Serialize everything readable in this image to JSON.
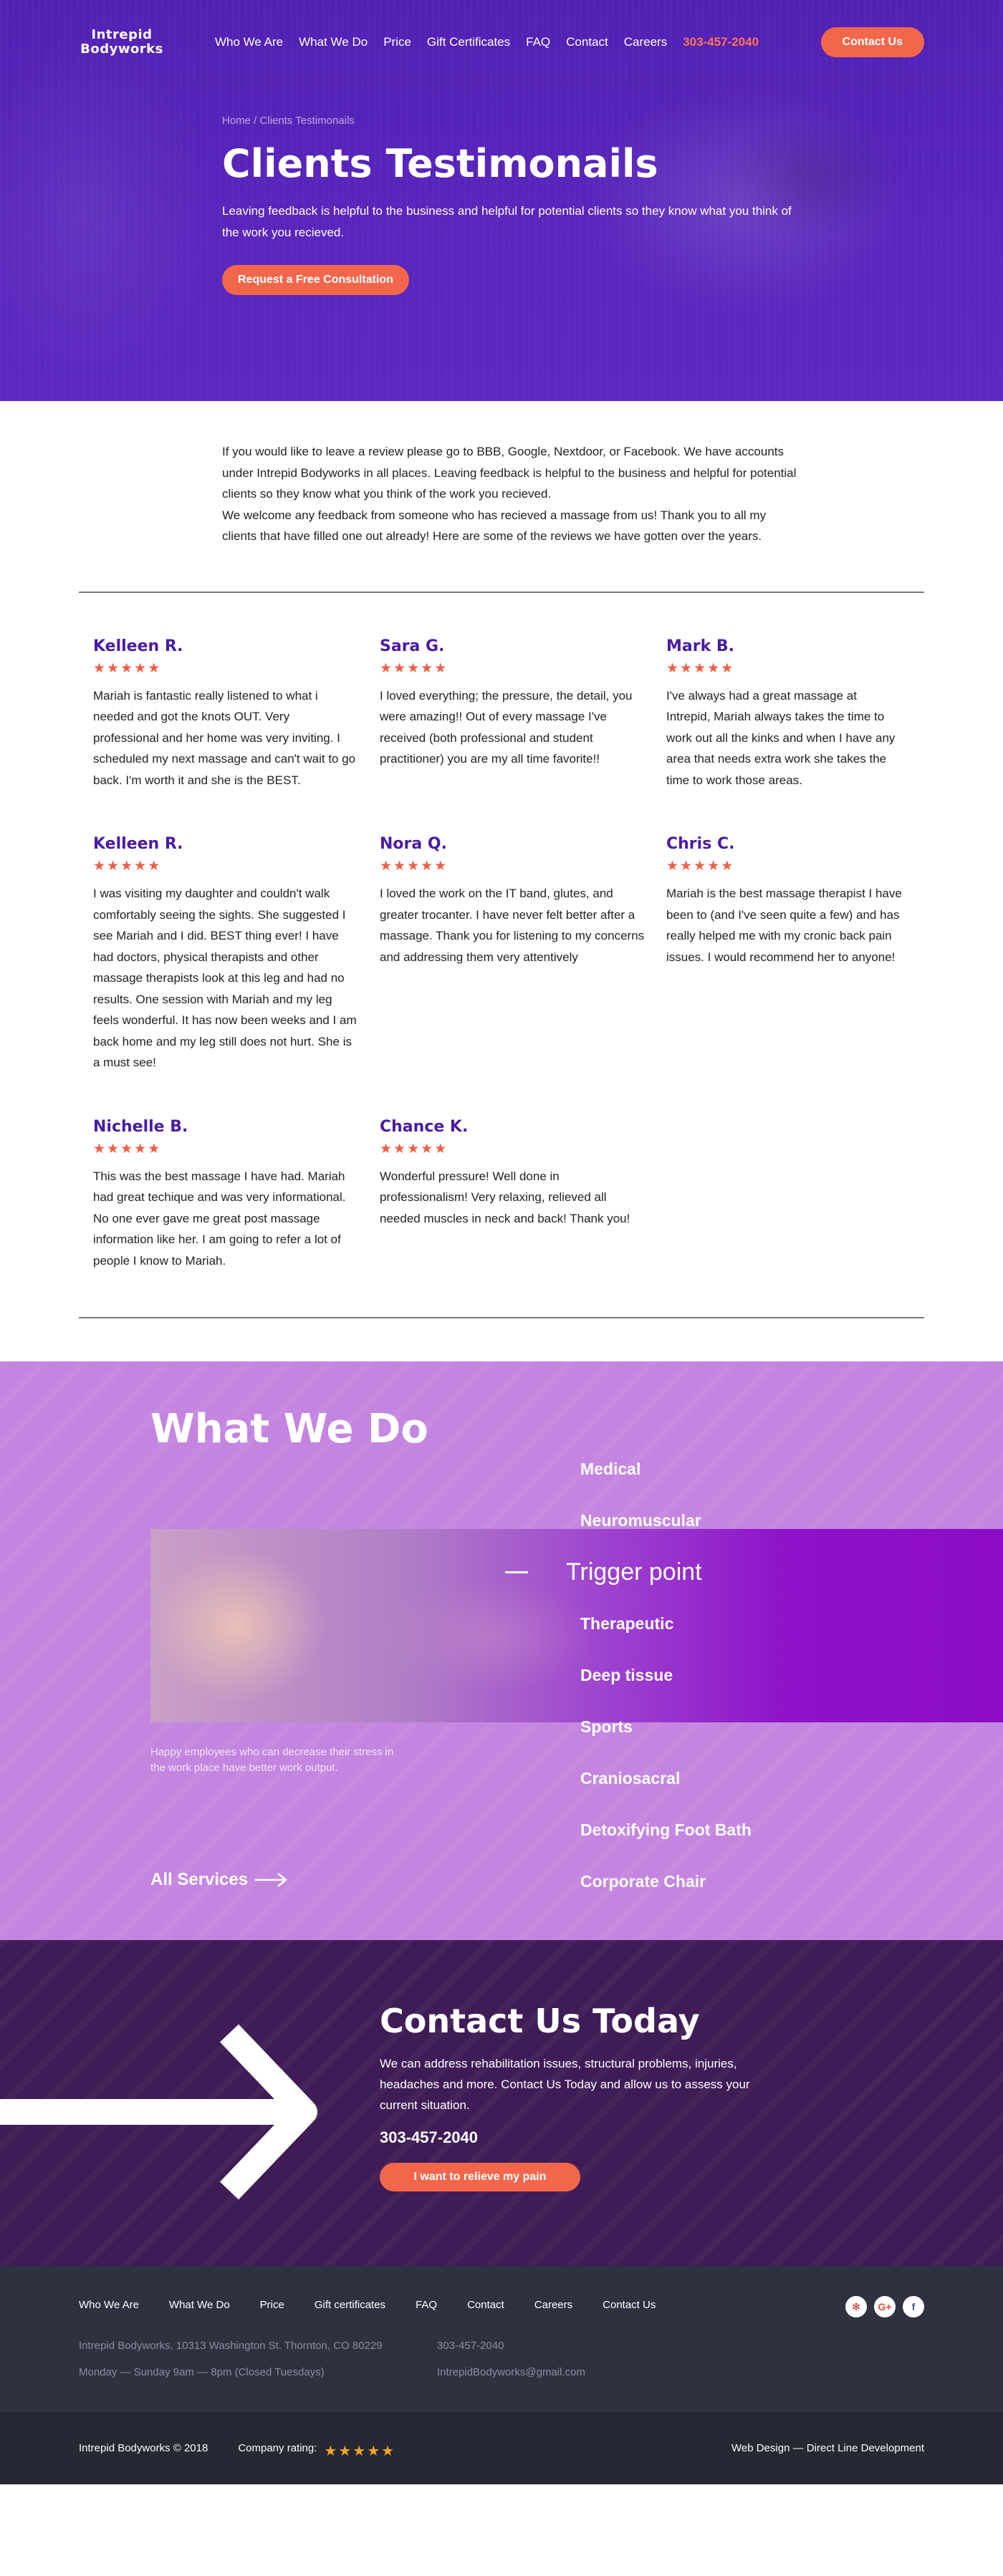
{
  "header": {
    "logo_line1": "Intrepid",
    "logo_line2": "Bodyworks",
    "nav": [
      "Who We Are",
      "What We Do",
      "Price",
      "Gift Certificates",
      "FAQ",
      "Contact",
      "Careers"
    ],
    "phone": "303-457-2040",
    "cta": "Contact Us"
  },
  "hero": {
    "breadcrumb_home": "Home",
    "breadcrumb_sep": " / ",
    "breadcrumb_current": "Clients Testimonails",
    "title": "Clients Testimonails",
    "subtitle": "Leaving feedback is helpful to the business and helpful for potential clients so they know what you think of the work you recieved.",
    "button": "Request a Free Consultation"
  },
  "intro": {
    "p1": "If you would like to leave a review please go to BBB, Google, Nextdoor, or Facebook.  We have accounts under Intrepid Bodyworks in all places.  Leaving feedback is helpful to the business and helpful for potential clients so they know what you think of the work you recieved.",
    "p2": "We welcome any feedback from someone who has recieved a massage from us! Thank you to all my clients that have filled one out already!  Here are some of the reviews we have gotten over the years."
  },
  "reviews": [
    {
      "name": "Kelleen R.",
      "stars": 5,
      "text": "Mariah is fantastic really listened to what i needed and got the knots OUT.  Very professional and her home was very inviting.  I scheduled my next massage and can't wait to go back.  I'm worth it and she is the BEST."
    },
    {
      "name": "Sara G.",
      "stars": 5,
      "text": "I loved everything; the pressure, the detail, you were amazing!!  Out of every massage I've received (both professional and student practitioner) you are my all time favorite!!"
    },
    {
      "name": "Mark B.",
      "stars": 5,
      "text": "I've always had a great massage at Intrepid, Mariah always takes the time to work out all the kinks and when I have any area that needs extra work she takes the time to work those areas."
    },
    {
      "name": "Kelleen R.",
      "stars": 5,
      "text": "I was visiting my daughter and couldn't walk comfortably seeing the sights.  She suggested I see Mariah and I did.  BEST thing ever!  I have had doctors, physical therapists and other massage therapists look at this leg and had no results.  One session with Mariah and my leg feels wonderful.  It has now been weeks and I am back home and my leg still does not hurt.  She is a must see!"
    },
    {
      "name": "Nora Q.",
      "stars": 5,
      "text": "I loved the work on the IT band, glutes, and greater trocanter.  I have never felt better after a massage.  Thank you for listening to my concerns and addressing them very attentively"
    },
    {
      "name": "Chris C.",
      "stars": 5,
      "text": "Mariah is the best massage therapist I have been to (and I've seen quite a few) and has really helped me with my cronic back pain issues.  I would recommend her to anyone!"
    },
    {
      "name": "Nichelle B.",
      "stars": 5,
      "text": "This was the best massage I have had.  Mariah had great techique and was very informational.  No one ever gave me great post massage information like her.  I am going to refer a lot of people I know to Mariah."
    },
    {
      "name": "Chance K.",
      "stars": 5,
      "text": "Wonderful pressure!  Well done in professionalism!  Very relaxing, relieved all needed muscles in neck and back!  Thank you!"
    }
  ],
  "what_we_do": {
    "title": "What We Do",
    "caption": "Happy employees who can decrease their stress in the work place have better work output.",
    "services": [
      "Medical",
      "Neuromuscular",
      "Trigger point",
      "Therapeutic",
      "Deep tissue",
      "Sports",
      "Craniosacral",
      "Detoxifying Foot Bath",
      "Corporate Chair"
    ],
    "active_service": "Trigger point",
    "all_services": "All Services"
  },
  "contact": {
    "title": "Contact Us Today",
    "text": "We can address rehabilitation issues, structural problems, injuries, headaches and more. Contact Us Today and allow us to assess your current situation.",
    "phone": "303-457-2040",
    "button": "I want to relieve my pain"
  },
  "footer": {
    "nav": [
      "Who We Are",
      "What We Do",
      "Price",
      "Gift certificates",
      "FAQ",
      "Contact",
      "Careers",
      "Contact Us"
    ],
    "social": [
      {
        "icon": "yelp-icon",
        "glyph": "✻",
        "color": "#d32323"
      },
      {
        "icon": "google-plus-icon",
        "glyph": "G+",
        "color": "#dd4b39"
      },
      {
        "icon": "facebook-icon",
        "glyph": "f",
        "color": "#3b5998"
      }
    ],
    "address": "Intrepid Bodyworks, 10313 Washington St. Thornton, CO 80229",
    "phone": "303-457-2040",
    "hours": "Monday — Sunday 9am — 8pm (Closed Tuesdays)",
    "email": "IntrepidBodyworks@gmail.com",
    "copyright": "Intrepid Bodyworks © 2018",
    "rating_label": "Company rating:",
    "rating": 5,
    "credit": "Web Design — Direct Line Development"
  },
  "colors": {
    "accent": "#f2674c",
    "hero_purple": "#5a23b8",
    "name_purple": "#4a1ca1",
    "services_bg": "#c485e0",
    "contact_bg": "#3f1c56",
    "footer_bg": "#2e3140"
  }
}
